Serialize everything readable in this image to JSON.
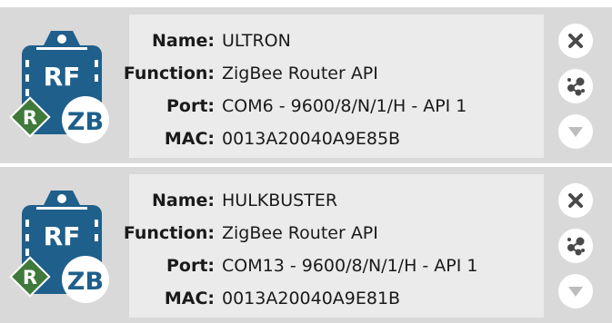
{
  "labels": {
    "name": "Name:",
    "function": "Function:",
    "port": "Port:",
    "mac": "MAC:"
  },
  "devices": [
    {
      "name": "ULTRON",
      "function": "ZigBee Router API",
      "port": "COM6 - 9600/8/N/1/H - API 1",
      "mac": "0013A20040A9E85B",
      "badge_role": "R",
      "badge_protocol": "ZB",
      "logo_text": "RF"
    },
    {
      "name": "HULKBUSTER",
      "function": "ZigBee Router API",
      "port": "COM13 - 9600/8/N/1/H - API 1",
      "mac": "0013A20040A9E81B",
      "badge_role": "R",
      "badge_protocol": "ZB",
      "logo_text": "RF"
    }
  ],
  "actions": {
    "remove_icon": "close-icon",
    "discover_icon": "network-discover-icon",
    "expand_icon": "chevron-down-icon"
  },
  "colors": {
    "card_bg": "#d9d9d9",
    "panel_bg": "#ebebeb",
    "module_blue": "#1f5f8b",
    "router_green": "#3f7a3a",
    "icon_dark": "#4a4a4a",
    "icon_disabled": "#bdbdbd"
  }
}
